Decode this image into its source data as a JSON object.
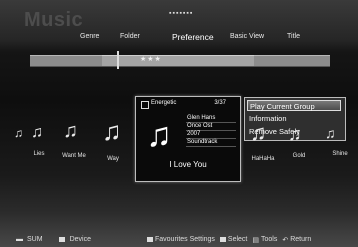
{
  "header": {
    "title": "Music",
    "page_dots": "▪▪▪▪▪▪▪",
    "tabs": [
      "Genre",
      "Folder",
      "Preference",
      "Basic View",
      "Title"
    ],
    "active_tab": "Preference"
  },
  "progress": {
    "stars": "★★★"
  },
  "songs": {
    "left": [
      "Lies",
      "Want Me",
      "Way"
    ],
    "right": [
      "HaHaHa",
      "Gold",
      "Shine"
    ]
  },
  "focused_card": {
    "mood": "Energetic",
    "count": "3/37",
    "meta": [
      "Glen Hans",
      "Once Ost",
      "2007",
      "Soundtrack"
    ],
    "title": "I Love You"
  },
  "context_menu": {
    "items": [
      "Play Current Group",
      "Information",
      "Remove Safely"
    ],
    "selected_index": 0
  },
  "footer": {
    "sum_label": "SUM",
    "device_label": "Device",
    "favourites_label": "Favourites Settings",
    "select_label": "Select",
    "tools_label": "Tools",
    "return_label": "Return"
  },
  "icons": [
    "music-note-icon",
    "checkbox-icon",
    "tv-icon",
    "tools-icon",
    "return-arrow-icon"
  ]
}
